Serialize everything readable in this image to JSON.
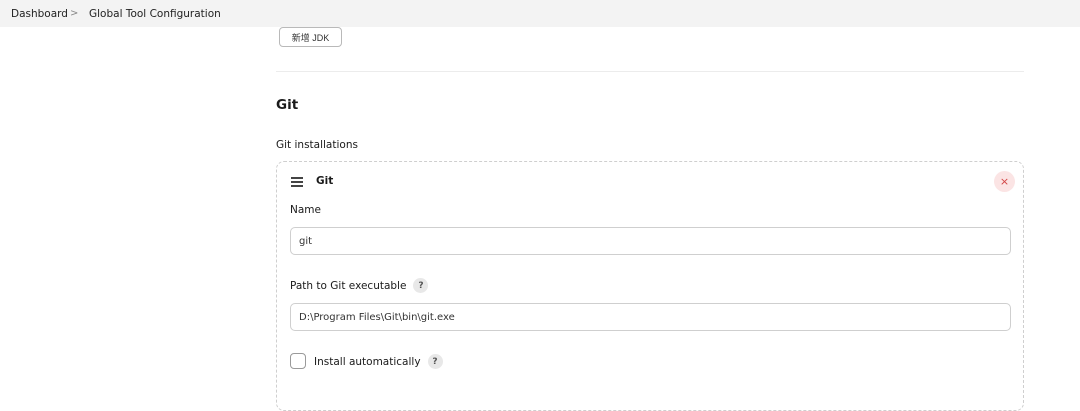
{
  "breadcrumb": {
    "items": [
      "Dashboard",
      "Global Tool Configuration"
    ],
    "separator": ">"
  },
  "jdk": {
    "add_button_label": "新增 JDK"
  },
  "git_section": {
    "title": "Git",
    "installations_label": "Git installations",
    "installation": {
      "title": "Git",
      "delete_icon": "×",
      "name_label": "Name",
      "name_value": "git",
      "path_label": "Path to Git executable",
      "path_value": "D:\\Program Files\\Git\\bin\\git.exe",
      "install_auto_label": "Install automatically",
      "install_auto_checked": false,
      "help_icon": "?"
    }
  },
  "colors": {
    "breadcrumb_bg": "#f3f3f3",
    "delete_bg": "#fbe4e4",
    "delete_fg": "#d24545"
  }
}
